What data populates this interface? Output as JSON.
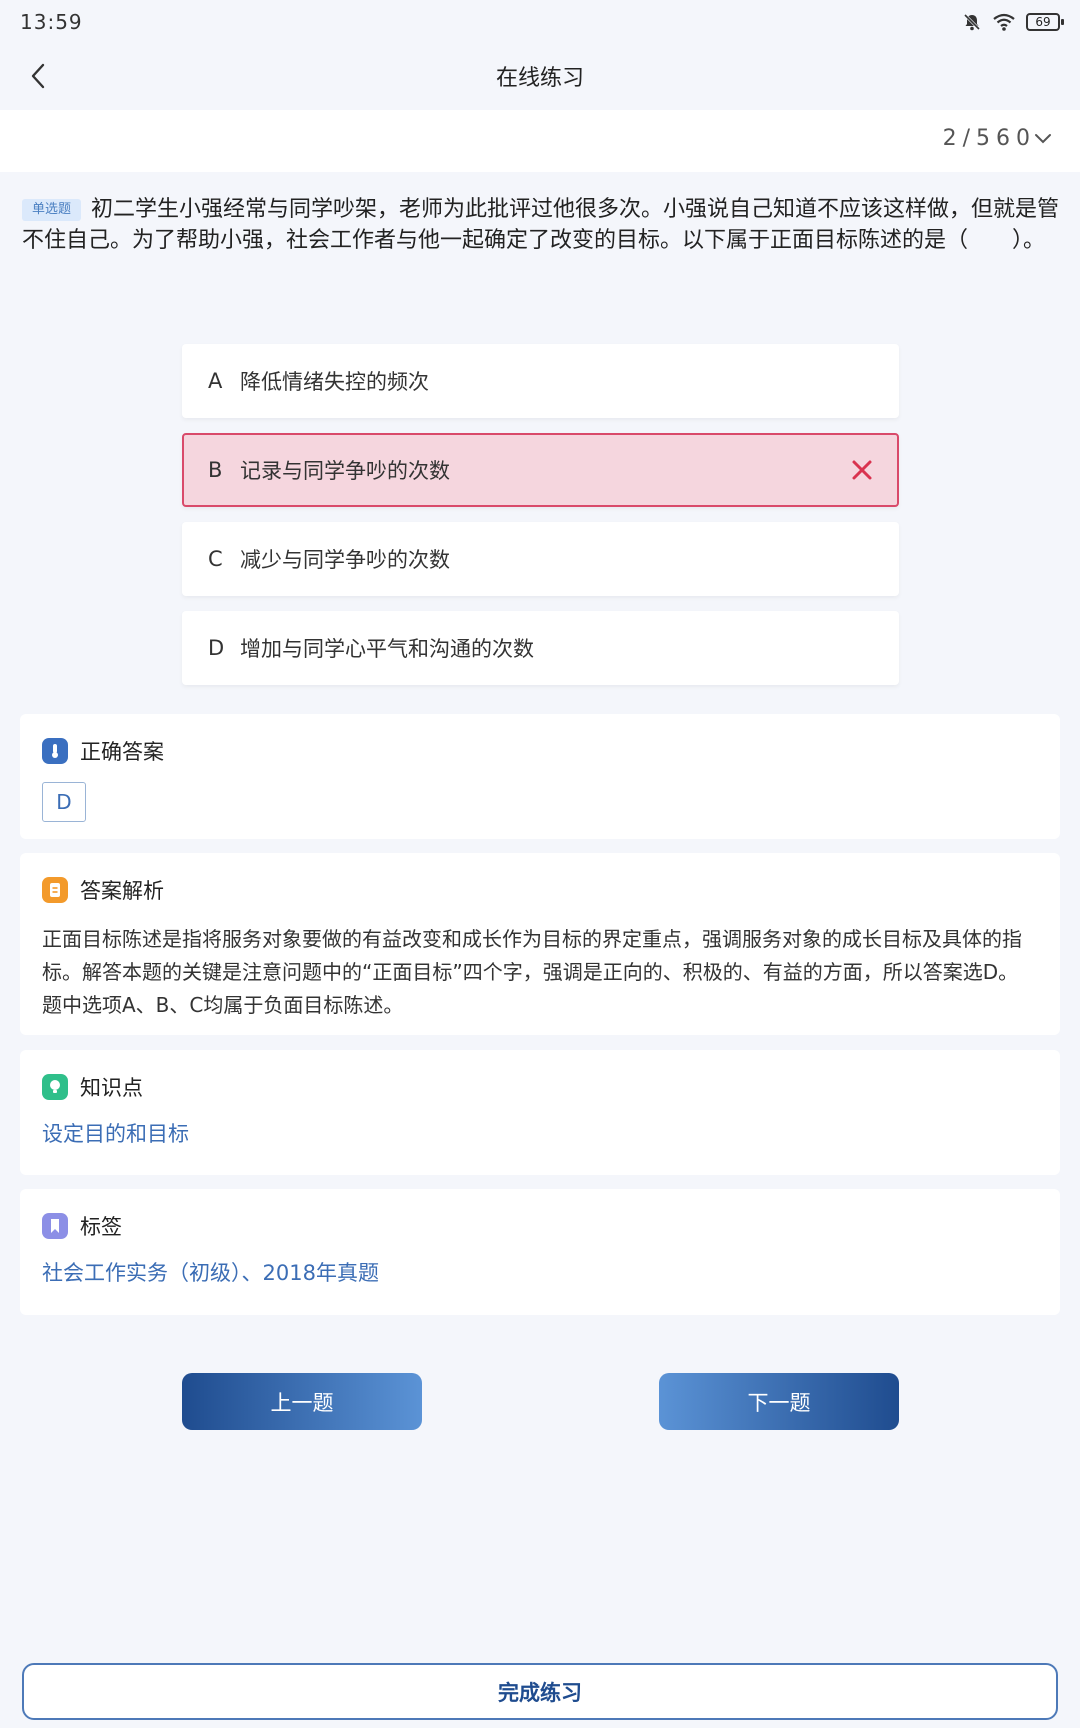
{
  "status": {
    "time": "13:59",
    "battery": "69"
  },
  "nav": {
    "title": "在线练习"
  },
  "counter": {
    "text": "2/560"
  },
  "question": {
    "type_badge": "单选题",
    "text": "初二学生小强经常与同学吵架，老师为此批评过他很多次。小强说自己知道不应该这样做，但就是管不住自己。为了帮助小强，社会工作者与他一起确定了改变的目标。以下属于正面目标陈述的是（　　）。"
  },
  "options": [
    {
      "letter": "A",
      "text": "降低情绪失控的频次",
      "state": "normal"
    },
    {
      "letter": "B",
      "text": "记录与同学争吵的次数",
      "state": "wrong"
    },
    {
      "letter": "C",
      "text": "减少与同学争吵的次数",
      "state": "normal"
    },
    {
      "letter": "D",
      "text": "增加与同学心平气和沟通的次数",
      "state": "normal"
    }
  ],
  "correct_answer": {
    "title": "正确答案",
    "value": "D",
    "icon": "thermometer-icon",
    "icon_color": "#3a6fc0"
  },
  "analysis": {
    "title": "答案解析",
    "icon": "document-icon",
    "icon_color": "#f39a2b",
    "text": "正面目标陈述是指将服务对象要做的有益改变和成长作为目标的界定重点，强调服务对象的成长目标及具体的指标。解答本题的关键是注意问题中的“正面目标”四个字，强调是正向的、积极的、有益的方面，所以答案选D。题中选项A、B、C均属于负面目标陈述。"
  },
  "knowledge": {
    "title": "知识点",
    "icon": "lightbulb-icon",
    "icon_color": "#2fbf8a",
    "value": "设定目的和目标"
  },
  "tags": {
    "title": "标签",
    "icon": "bookmark-icon",
    "icon_color": "#8c8fe6",
    "value": "社会工作实务（初级）、2018年真题"
  },
  "buttons": {
    "prev": "上一题",
    "next": "下一题",
    "finish": "完成练习"
  }
}
